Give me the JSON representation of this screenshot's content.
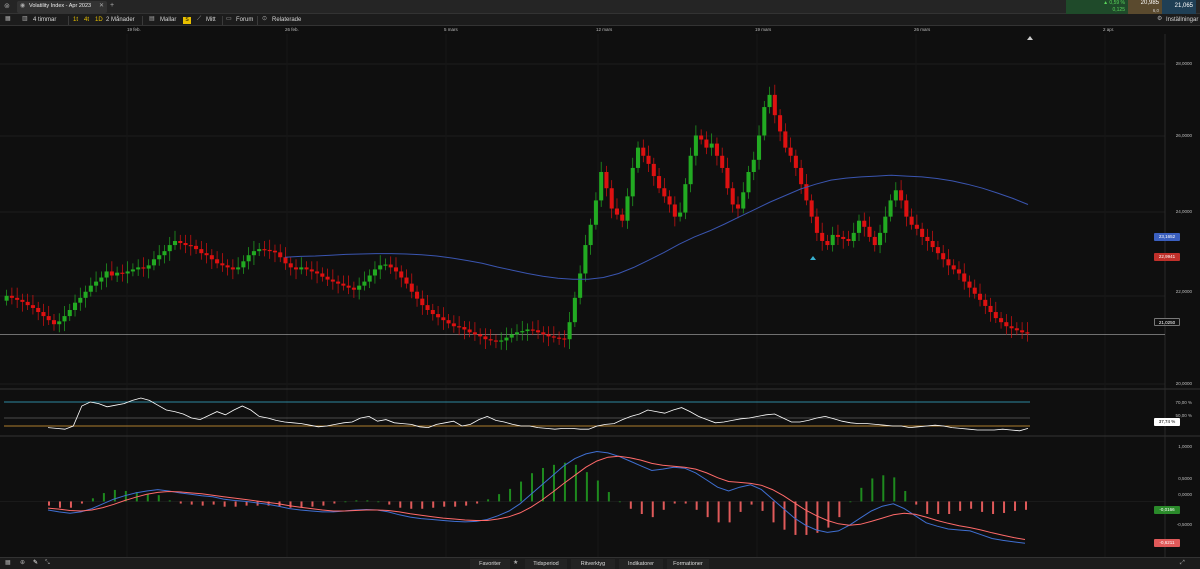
{
  "window": {
    "title": "Volatility Index - Apr 2023"
  },
  "header_price": {
    "change_pct": "0,59 %",
    "change_abs": "0,125",
    "bid": "20,985",
    "bid_sub": "6,0",
    "ask": "21,065"
  },
  "toolbar": {
    "interval": "4 timmar",
    "period_short": [
      "1t",
      "4t",
      "1D"
    ],
    "period": "2 Månader",
    "templates": "Mallar",
    "s_badge": "S",
    "mine": "Mitt",
    "forum": "Forum",
    "related": "Relaterade",
    "settings": "Inställningar"
  },
  "date_axis": [
    "19 feb.",
    "26 feb.",
    "5 mars",
    "12 mars",
    "19 mars",
    "26 mars",
    "2 apr."
  ],
  "price_axis": [
    "28,0000",
    "26,0000",
    "24,0000",
    "22,0000",
    "20,0000"
  ],
  "rsi_axis": [
    "70,00 %",
    "50,00 %"
  ],
  "macd_axis": [
    "1,0000",
    "0,5000",
    "0,0000",
    "-0,5000"
  ],
  "tags": {
    "ma": "23,1652",
    "current_red": "22,9941",
    "last": "21,0250",
    "rsi": "37,74 %",
    "macd": "-0,0166",
    "signal": "-0,6211"
  },
  "bottom": {
    "favorites": "Favoriter",
    "time": "Tidsperiod",
    "drawing": "Ritverktyg",
    "indicators": "Indikatorer",
    "formations": "Formationer"
  },
  "colors": {
    "up": "#22aa22",
    "down": "#dd1111",
    "ma": "#3a55b0",
    "macd": "#3f6fd1",
    "signal": "#ff6a6a",
    "rsi": "#ffffff",
    "rsi_upper": "#37b0d0",
    "rsi_lower": "#e3a23a"
  },
  "chart_data": {
    "type": "candlestick",
    "y_range": [
      19.9,
      28.4
    ],
    "closes": [
      21.95,
      21.9,
      21.85,
      21.8,
      21.72,
      21.65,
      21.55,
      21.45,
      21.35,
      21.25,
      21.32,
      21.45,
      21.6,
      21.78,
      21.9,
      22.05,
      22.2,
      22.3,
      22.4,
      22.55,
      22.45,
      22.52,
      22.5,
      22.55,
      22.6,
      22.65,
      22.62,
      22.7,
      22.85,
      22.95,
      23.05,
      23.2,
      23.3,
      23.25,
      23.2,
      23.18,
      23.1,
      23.0,
      22.95,
      22.85,
      22.75,
      22.7,
      22.65,
      22.6,
      22.65,
      22.8,
      22.95,
      23.05,
      23.1,
      23.08,
      23.06,
      23.02,
      22.9,
      22.75,
      22.65,
      22.6,
      22.65,
      22.6,
      22.55,
      22.5,
      22.42,
      22.35,
      22.3,
      22.25,
      22.2,
      22.15,
      22.1,
      22.2,
      22.3,
      22.45,
      22.6,
      22.7,
      22.72,
      22.65,
      22.55,
      22.4,
      22.25,
      22.05,
      21.88,
      21.72,
      21.6,
      21.5,
      21.42,
      21.35,
      21.27,
      21.2,
      21.18,
      21.12,
      21.05,
      21.0,
      20.95,
      20.88,
      20.85,
      20.82,
      20.85,
      20.92,
      21.0,
      21.05,
      21.08,
      21.12,
      21.1,
      21.05,
      21.0,
      20.95,
      20.92,
      20.9,
      20.88,
      21.3,
      21.9,
      22.5,
      23.2,
      23.7,
      24.3,
      25.0,
      24.6,
      24.1,
      23.95,
      23.8,
      24.4,
      25.1,
      25.6,
      25.4,
      25.2,
      24.9,
      24.6,
      24.4,
      24.2,
      23.9,
      24.0,
      24.7,
      25.4,
      25.9,
      25.8,
      25.6,
      25.7,
      25.4,
      25.1,
      24.6,
      24.2,
      24.1,
      24.5,
      25.0,
      25.3,
      25.9,
      26.6,
      26.9,
      26.4,
      26.0,
      25.6,
      25.4,
      25.1,
      24.7,
      24.3,
      23.9,
      23.5,
      23.3,
      23.2,
      23.45,
      23.4,
      23.35,
      23.3,
      23.5,
      23.8,
      23.65,
      23.4,
      23.2,
      23.5,
      23.9,
      24.3,
      24.55,
      24.3,
      23.9,
      23.7,
      23.6,
      23.4,
      23.3,
      23.15,
      23.0,
      22.85,
      22.7,
      22.6,
      22.5,
      22.3,
      22.15,
      22.0,
      21.85,
      21.7,
      21.55,
      21.4,
      21.3,
      21.2,
      21.15,
      21.1,
      21.05,
      21.02
    ],
    "opens_delta": 0.12,
    "ma": [
      22.9,
      22.92,
      22.93,
      22.95,
      22.97,
      22.98,
      22.99,
      22.99,
      22.98,
      22.96,
      22.93,
      22.88,
      22.82,
      22.75,
      22.66,
      22.58,
      22.5,
      22.43,
      22.38,
      22.36,
      22.36,
      22.4,
      22.5,
      22.65,
      22.83,
      23.02,
      23.22,
      23.4,
      23.55,
      23.72,
      23.9,
      24.08,
      24.26,
      24.42,
      24.58,
      24.7,
      24.8,
      24.85,
      24.88,
      24.9,
      24.92,
      24.9,
      24.88,
      24.84,
      24.78,
      24.7,
      24.6,
      24.48,
      24.35,
      24.2
    ],
    "rsi": [
      38,
      37,
      36,
      40,
      65,
      70,
      68,
      64,
      66,
      68,
      72,
      75,
      72,
      66,
      60,
      58,
      55,
      50,
      48,
      53,
      58,
      54,
      60,
      65,
      60,
      52,
      50,
      47,
      45,
      44,
      43,
      41,
      39,
      40,
      42,
      44,
      45,
      50,
      52,
      46,
      48,
      44,
      43,
      42,
      39,
      38,
      42,
      44,
      46,
      40,
      42,
      48,
      52,
      47,
      45,
      42,
      40,
      40,
      38,
      37,
      36,
      37,
      37,
      36,
      36,
      40,
      42,
      43,
      48,
      52,
      55,
      60,
      58,
      56,
      60,
      63,
      58,
      52,
      48,
      44,
      45,
      47,
      49,
      50,
      52,
      54,
      55,
      50,
      45,
      45,
      47,
      50,
      52,
      49,
      46,
      44,
      43,
      43,
      42,
      41,
      40,
      40,
      38,
      39,
      40,
      41,
      40,
      38,
      37,
      36,
      35,
      35,
      35,
      36,
      35,
      34,
      37
    ],
    "macd": [
      -0.18,
      -0.22,
      -0.25,
      -0.22,
      -0.15,
      -0.05,
      0.05,
      0.12,
      0.18,
      0.22,
      0.25,
      0.22,
      0.18,
      0.15,
      0.12,
      0.1,
      0.05,
      0.02,
      0.0,
      -0.03,
      -0.06,
      -0.1,
      -0.15,
      -0.18,
      -0.2,
      -0.22,
      -0.22,
      -0.2,
      -0.18,
      -0.17,
      -0.18,
      -0.22,
      -0.28,
      -0.33,
      -0.36,
      -0.38,
      -0.4,
      -0.42,
      -0.43,
      -0.42,
      -0.38,
      -0.3,
      -0.2,
      -0.05,
      0.15,
      0.35,
      0.55,
      0.75,
      0.9,
      1.0,
      1.05,
      1.02,
      0.95,
      0.85,
      0.75,
      0.65,
      0.68,
      0.72,
      0.7,
      0.6,
      0.45,
      0.3,
      0.22,
      0.3,
      0.35,
      0.25,
      0.05,
      -0.15,
      -0.35,
      -0.5,
      -0.6,
      -0.65,
      -0.62,
      -0.5,
      -0.35,
      -0.2,
      -0.1,
      -0.05,
      -0.15,
      -0.3,
      -0.45,
      -0.52,
      -0.58,
      -0.6,
      -0.62,
      -0.7,
      -0.78,
      -0.82,
      -0.85,
      -0.88
    ],
    "signal": [
      -0.14,
      -0.16,
      -0.19,
      -0.2,
      -0.18,
      -0.13,
      -0.06,
      0.02,
      0.09,
      0.15,
      0.19,
      0.21,
      0.2,
      0.18,
      0.16,
      0.13,
      0.1,
      0.07,
      0.04,
      0.01,
      -0.02,
      -0.05,
      -0.09,
      -0.12,
      -0.15,
      -0.18,
      -0.2,
      -0.2,
      -0.19,
      -0.18,
      -0.18,
      -0.19,
      -0.22,
      -0.26,
      -0.29,
      -0.32,
      -0.35,
      -0.37,
      -0.39,
      -0.4,
      -0.4,
      -0.37,
      -0.32,
      -0.24,
      -0.12,
      0.03,
      0.2,
      0.38,
      0.55,
      0.72,
      0.85,
      0.93,
      0.95,
      0.92,
      0.87,
      0.8,
      0.76,
      0.74,
      0.72,
      0.68,
      0.6,
      0.5,
      0.42,
      0.4,
      0.38,
      0.34,
      0.25,
      0.12,
      -0.03,
      -0.18,
      -0.3,
      -0.4,
      -0.47,
      -0.5,
      -0.48,
      -0.42,
      -0.35,
      -0.28,
      -0.25,
      -0.27,
      -0.33,
      -0.4,
      -0.46,
      -0.51,
      -0.55,
      -0.6,
      -0.66,
      -0.71,
      -0.76,
      -0.8
    ]
  }
}
